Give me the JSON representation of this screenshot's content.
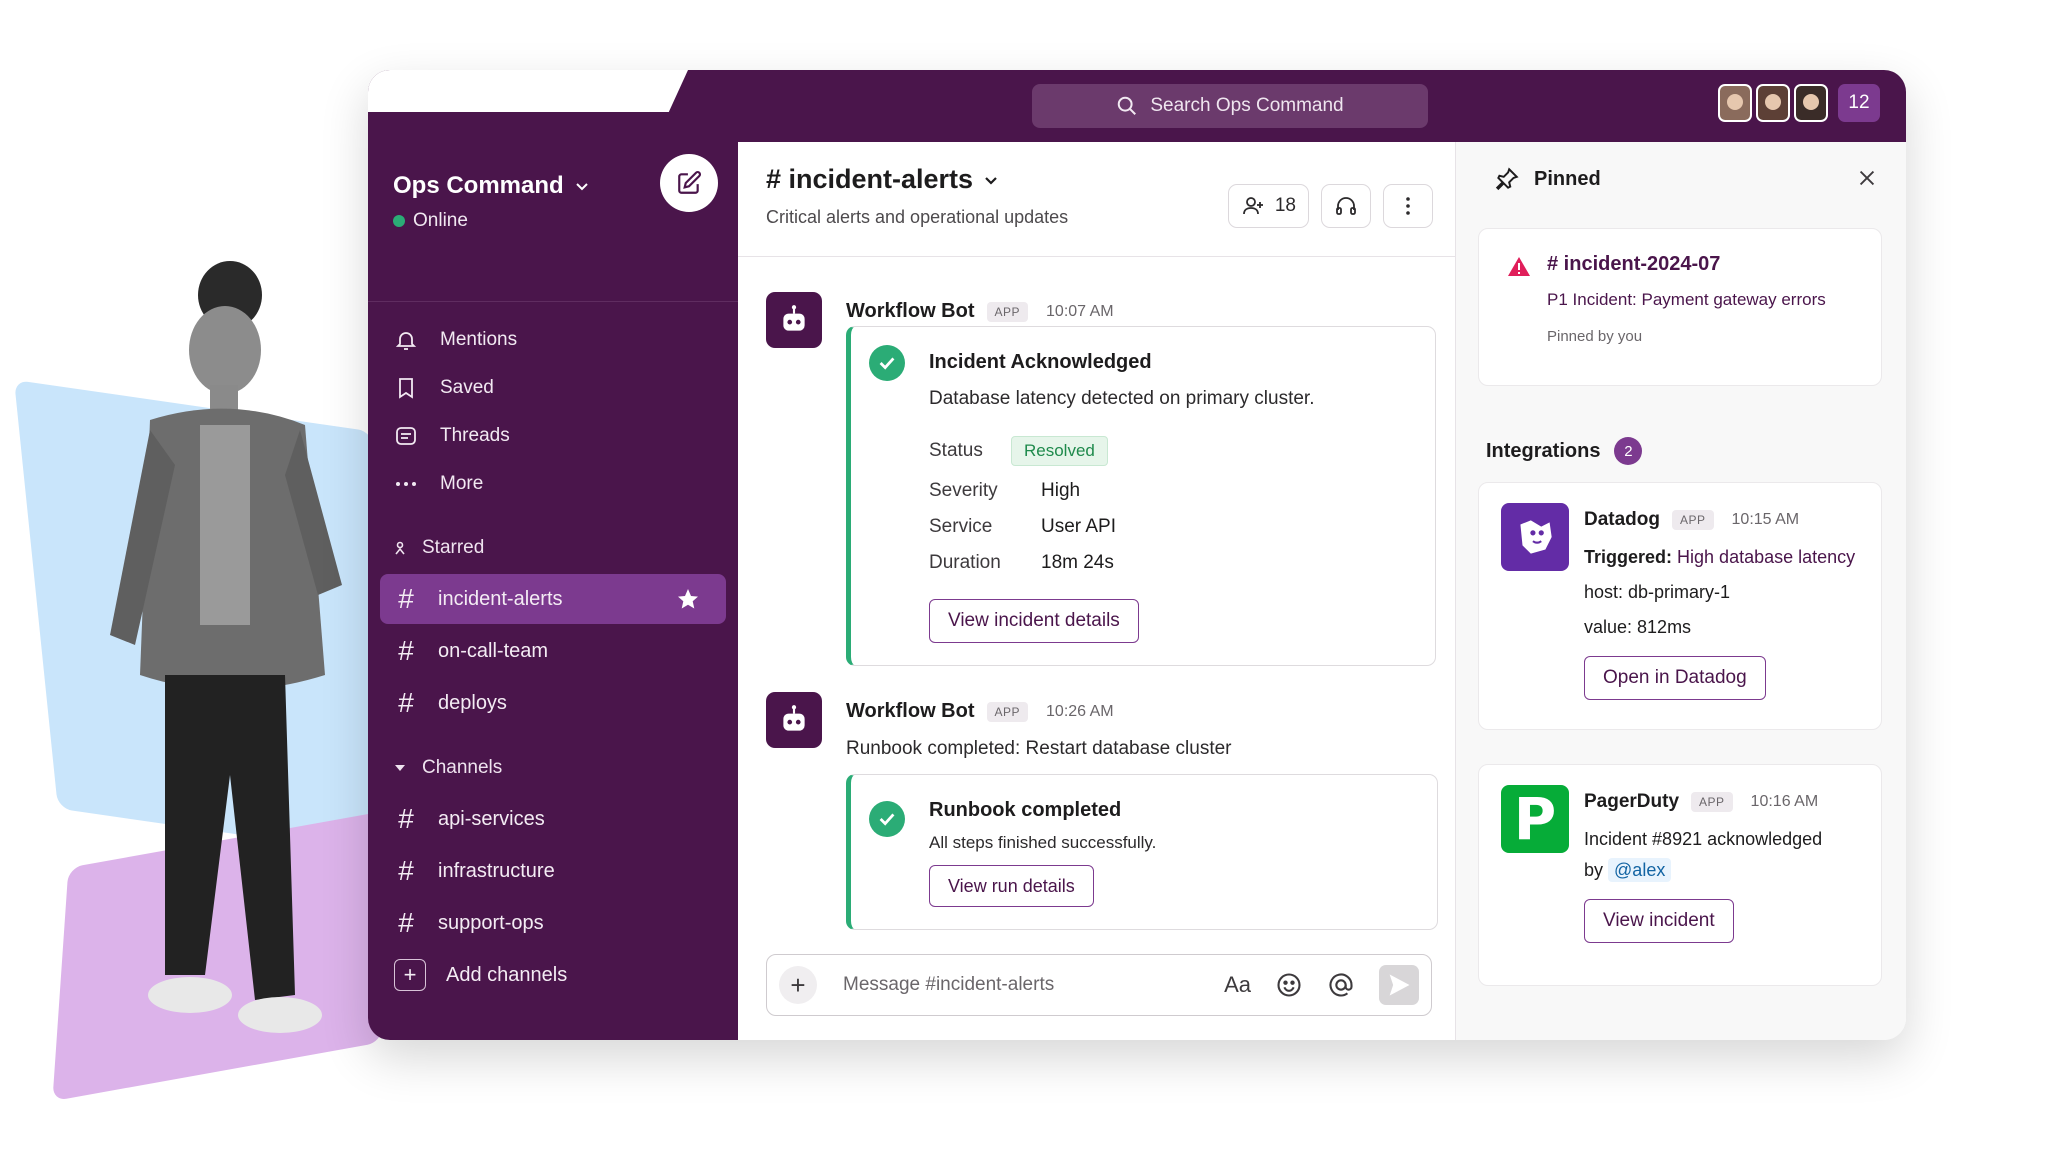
{
  "workspace": {
    "name": "Ops Command",
    "status": "Online"
  },
  "search": {
    "placeholder": "Search Ops Command"
  },
  "topbar": {
    "member_count_badge": "12"
  },
  "sidebar": {
    "nav": [
      {
        "label": "Mentions",
        "icon": "bell-icon"
      },
      {
        "label": "Saved",
        "icon": "bookmark-icon"
      },
      {
        "label": "Threads",
        "icon": "threads-icon"
      },
      {
        "label": "More",
        "icon": "more-dots-icon"
      }
    ],
    "starred_label": "Starred",
    "starred": [
      {
        "name": "incident-alerts",
        "active": true
      },
      {
        "name": "on-call-team"
      },
      {
        "name": "deploys"
      }
    ],
    "channels_label": "Channels",
    "channels": [
      {
        "name": "api-services"
      },
      {
        "name": "infrastructure"
      },
      {
        "name": "support-ops"
      }
    ],
    "add_channels": "Add channels"
  },
  "channel": {
    "title": "# incident-alerts",
    "description": "Critical alerts and operational updates",
    "member_count": "18"
  },
  "messages": [
    {
      "author": "Workflow Bot",
      "tag": "APP",
      "time": "10:07 AM",
      "card": {
        "title": "Incident Acknowledged",
        "text": "Database latency detected on primary cluster.",
        "fields": [
          {
            "key": "Status",
            "value": "Resolved"
          },
          {
            "key": "Severity",
            "value": "High"
          },
          {
            "key": "Service",
            "value": "User API"
          },
          {
            "key": "Duration",
            "value": "18m 24s"
          }
        ],
        "button": "View incident details"
      }
    },
    {
      "author": "Workflow Bot",
      "tag": "APP",
      "time": "10:26 AM",
      "text": "Runbook completed: Restart database cluster",
      "card": {
        "title": "Runbook completed",
        "text": "All steps finished successfully.",
        "button": "View run details"
      }
    }
  ],
  "composer": {
    "placeholder": "Message #incident-alerts",
    "format_label": "Aa"
  },
  "right_panel": {
    "pinned_title": "Pinned",
    "pinned_item": {
      "title": "# incident-2024-07",
      "subtitle": "P1 Incident: Payment gateway errors",
      "by": "Pinned by you"
    },
    "integrations_title": "Integrations",
    "integrations_count": "2",
    "integrations": [
      {
        "name": "Datadog",
        "tag": "APP",
        "time": "10:15 AM",
        "triggered_label": "Triggered:",
        "triggered_text": "High database latency",
        "line1": "host: db-primary-1",
        "line2": "value: 812ms",
        "button": "Open in Datadog"
      },
      {
        "name": "PagerDuty",
        "tag": "APP",
        "time": "10:16 AM",
        "text": "Incident #8921 acknowledged",
        "by_label": "by",
        "mention": "@alex",
        "button": "View incident",
        "logo_letter": "P"
      }
    ]
  },
  "colors": {
    "aubergine": "#4a154b",
    "active_channel": "#7c3a8f",
    "success": "#2bac76",
    "datadog": "#632ca6",
    "pagerduty": "#06ac38"
  }
}
